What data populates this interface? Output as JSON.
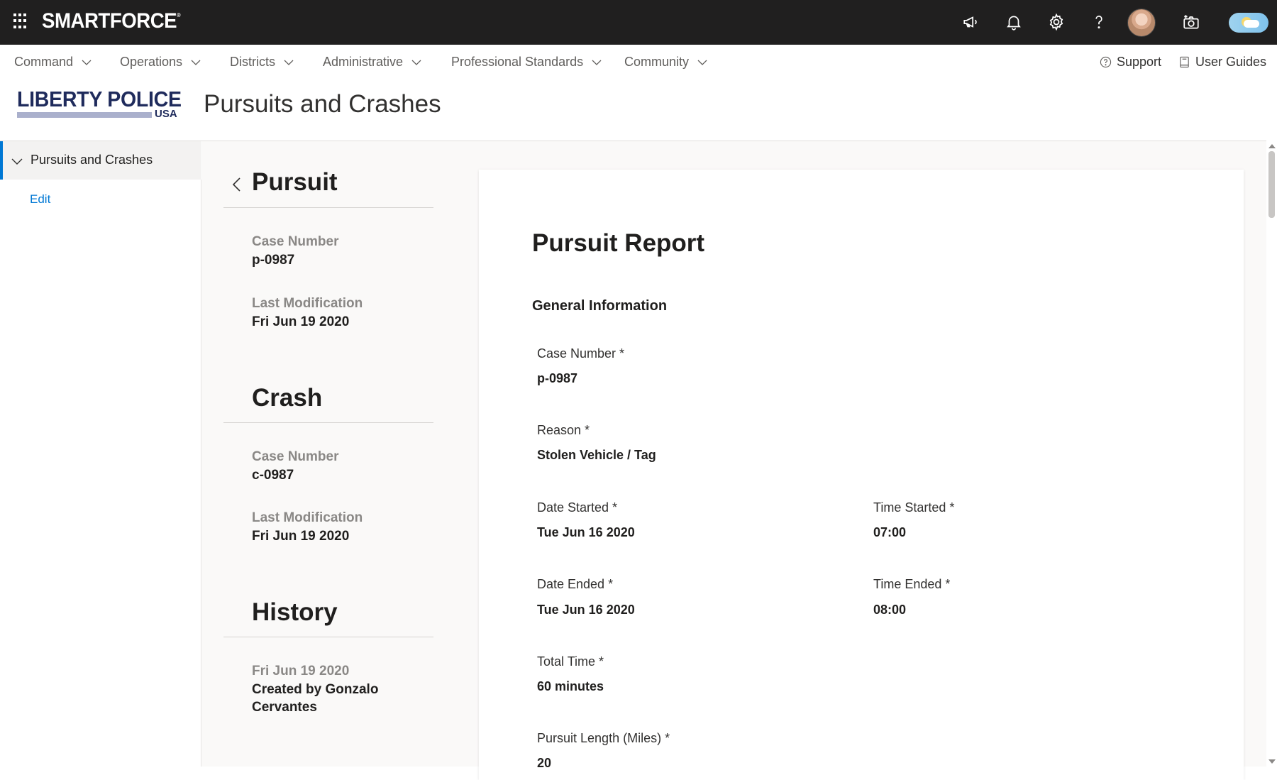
{
  "topbar": {
    "brand": "SMARTFORCE",
    "brand_mark": "®",
    "icons": [
      "waffle-icon",
      "megaphone-icon",
      "bell-icon",
      "gear-icon",
      "help-icon",
      "avatar",
      "camera-add-icon",
      "theme-toggle"
    ]
  },
  "nav": {
    "items": [
      {
        "label": "Command"
      },
      {
        "label": "Operations"
      },
      {
        "label": "Districts"
      },
      {
        "label": "Administrative"
      },
      {
        "label": "Professional Standards"
      },
      {
        "label": "Community"
      }
    ],
    "support": "Support",
    "user_guides": "User Guides"
  },
  "header": {
    "logo_line1": "LIBERTY POLICE",
    "logo_line2": "USA",
    "page_title": "Pursuits and Crashes"
  },
  "sidebar": {
    "active": "Pursuits and Crashes",
    "edit": "Edit"
  },
  "summary": {
    "pursuit": {
      "title": "Pursuit",
      "case_label": "Case Number",
      "case_value": "p-0987",
      "mod_label": "Last Modification",
      "mod_value": "Fri Jun 19 2020"
    },
    "crash": {
      "title": "Crash",
      "case_label": "Case Number",
      "case_value": "c-0987",
      "mod_label": "Last Modification",
      "mod_value": "Fri Jun 19 2020"
    },
    "history": {
      "title": "History",
      "date": "Fri Jun 19 2020",
      "entry_line1": "Created by Gonzalo",
      "entry_line2": "Cervantes"
    }
  },
  "report": {
    "title": "Pursuit Report",
    "section": "General Information",
    "fields": {
      "case_number": {
        "label": "Case Number *",
        "value": "p-0987"
      },
      "reason": {
        "label": "Reason *",
        "value": "Stolen Vehicle / Tag"
      },
      "date_started": {
        "label": "Date Started *",
        "value": "Tue Jun 16 2020"
      },
      "time_started": {
        "label": "Time Started *",
        "value": "07:00"
      },
      "date_ended": {
        "label": "Date Ended *",
        "value": "Tue Jun 16 2020"
      },
      "time_ended": {
        "label": "Time Ended *",
        "value": "08:00"
      },
      "total_time": {
        "label": "Total Time *",
        "value": "60 minutes"
      },
      "pursuit_length": {
        "label": "Pursuit Length (Miles) *",
        "value": "20"
      }
    }
  },
  "colors": {
    "topbar": "#201f1f",
    "accent": "#0078d4",
    "logo": "#1f2b5c"
  }
}
